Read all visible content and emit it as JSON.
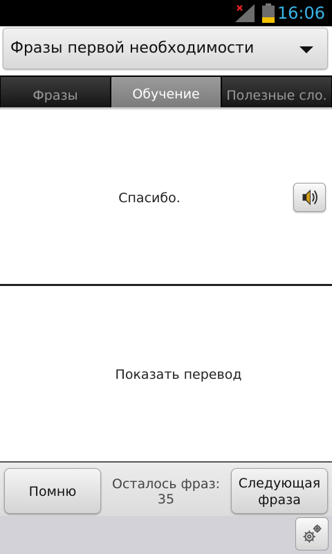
{
  "status_bar": {
    "time": "16:06",
    "signal_icon": "signal-no-service-icon",
    "battery_icon": "battery-low-icon",
    "battery_level": 0.3,
    "colors": {
      "time": "#39b5e8",
      "battery_fill": "#f2c200",
      "no_signal_x": "#e02020"
    }
  },
  "category_selector": {
    "value": "Фразы первой необходимости",
    "icon": "chevron-down-icon"
  },
  "tabs": [
    {
      "label": "Фразы",
      "active": false
    },
    {
      "label": "Обучение",
      "active": true
    },
    {
      "label": "Полезные сло.",
      "active": false
    }
  ],
  "phrase": {
    "text": "Спасибо.",
    "sound_icon": "speaker-icon"
  },
  "translation": {
    "prompt": "Показать перевод"
  },
  "bottom_bar": {
    "remember_label": "Помню",
    "remaining_label": "Осталось фраз:",
    "remaining_count": "35",
    "next_label_line1": "Следующая",
    "next_label_line2": "фраза",
    "settings_icon": "settings-gear-icon"
  }
}
